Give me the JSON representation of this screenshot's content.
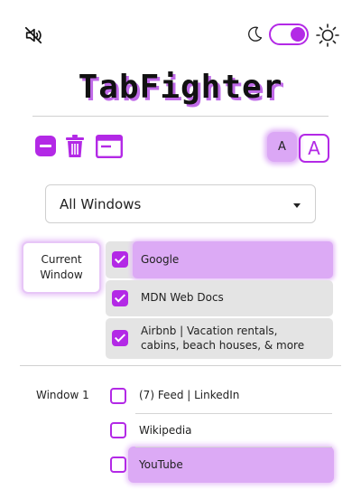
{
  "header": {
    "mute_icon": "speaker-mute-icon",
    "moon_icon": "moon-icon",
    "sun_icon": "sun-icon",
    "theme_toggle_on": true,
    "accent_color": "#b329e6",
    "highlight_color": "#dcaaf5"
  },
  "title": "TabFighter",
  "toolbar": {
    "icons": [
      "minus-square-icon",
      "trash-icon",
      "browser-window-icon"
    ],
    "font_small_label": "A",
    "font_large_label": "A"
  },
  "window_select": {
    "value": "All Windows"
  },
  "groups": [
    {
      "label": "Current Window",
      "tabs": [
        {
          "title": "Google",
          "checked": true,
          "highlighted": true
        },
        {
          "title": "MDN Web Docs",
          "checked": true
        },
        {
          "title": "Airbnb | Vacation rentals, cabins, beach houses, & more",
          "checked": true
        }
      ]
    },
    {
      "label": "Window 1",
      "tabs": [
        {
          "title": "(7) Feed | LinkedIn",
          "checked": false
        },
        {
          "title": "Wikipedia",
          "checked": false
        },
        {
          "title": "YouTube",
          "checked": false,
          "highlighted": true
        }
      ]
    }
  ]
}
